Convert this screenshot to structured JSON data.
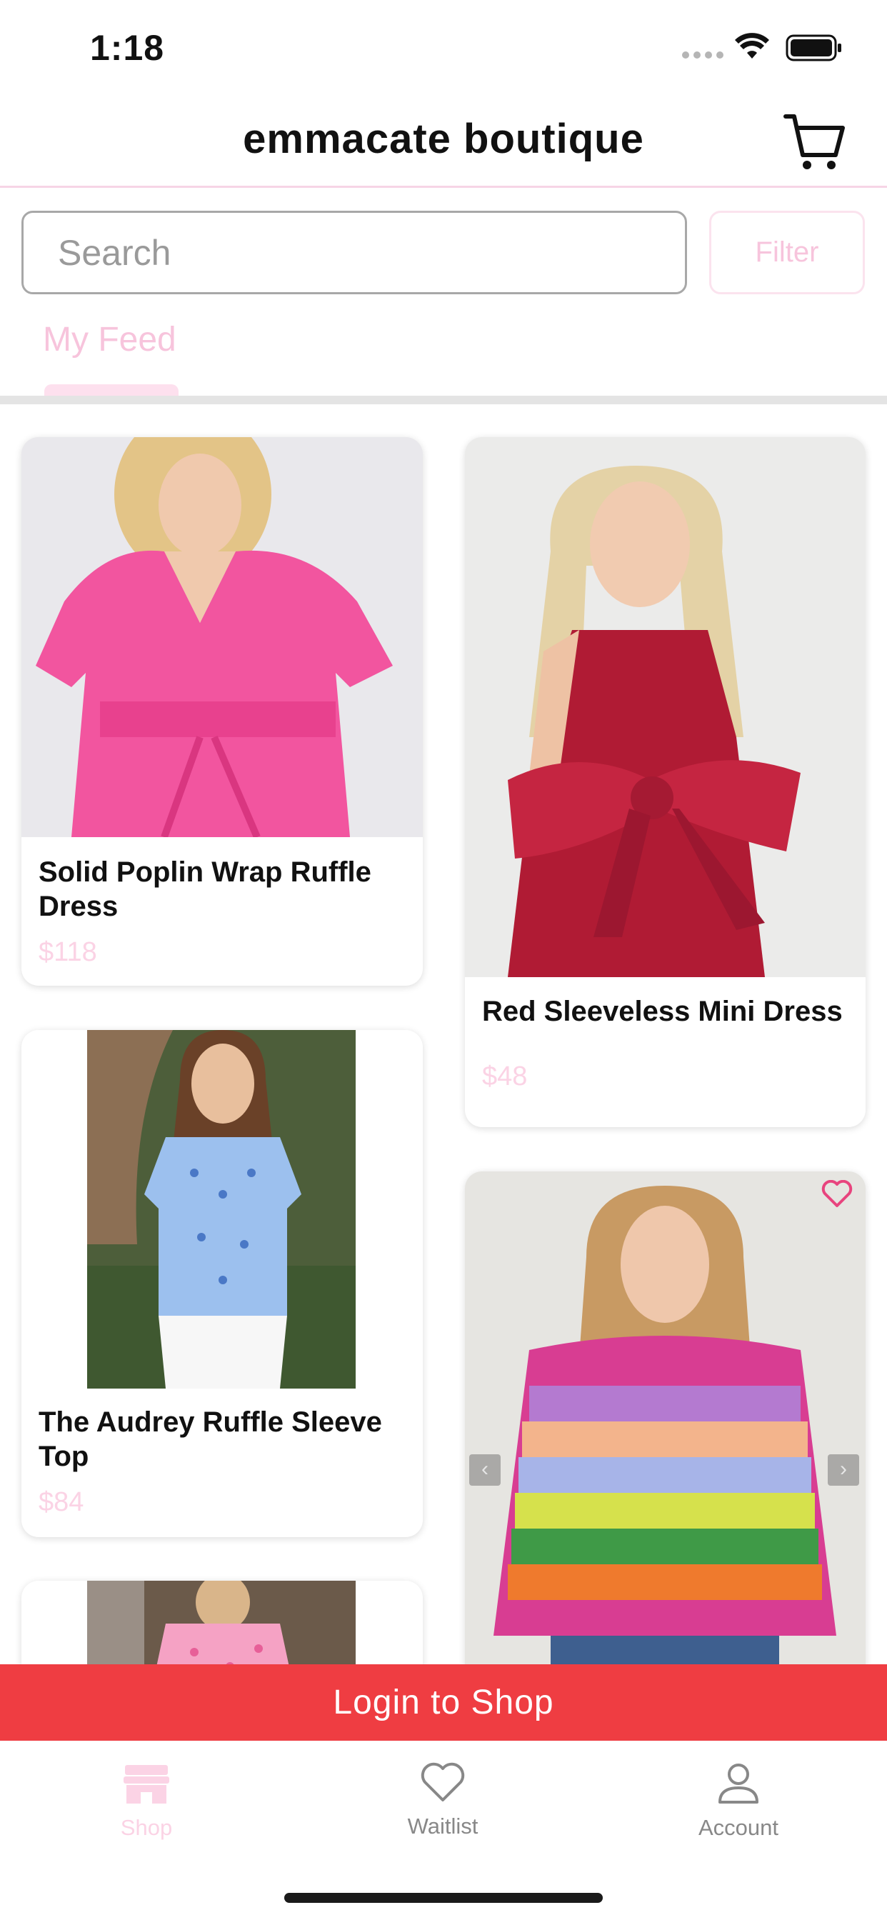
{
  "status_bar": {
    "time": "1:18"
  },
  "header": {
    "title": "emmacate boutique",
    "cart_icon": "cart-icon"
  },
  "search": {
    "placeholder": "Search",
    "filter_label": "Filter"
  },
  "tabs": [
    {
      "label": "My Feed",
      "active": true
    }
  ],
  "products": [
    {
      "title": "Solid Poplin Wrap Ruffle Dress",
      "price": "$118"
    },
    {
      "title": "Red Sleeveless Mini Dress",
      "price": "$48"
    },
    {
      "title": "The Audrey Ruffle Sleeve Top",
      "price": "$84"
    }
  ],
  "login_banner": {
    "label": "Login to Shop"
  },
  "bottom_nav": [
    {
      "label": "Shop",
      "icon": "storefront-icon",
      "active": true
    },
    {
      "label": "Waitlist",
      "icon": "heart-icon",
      "active": false
    },
    {
      "label": "Account",
      "icon": "person-icon",
      "active": false
    }
  ],
  "colors": {
    "accent_pink": "#f7c4dc",
    "banner_red": "#ef3d42",
    "heart_pink": "#e8447e",
    "nav_gray": "#888888"
  }
}
